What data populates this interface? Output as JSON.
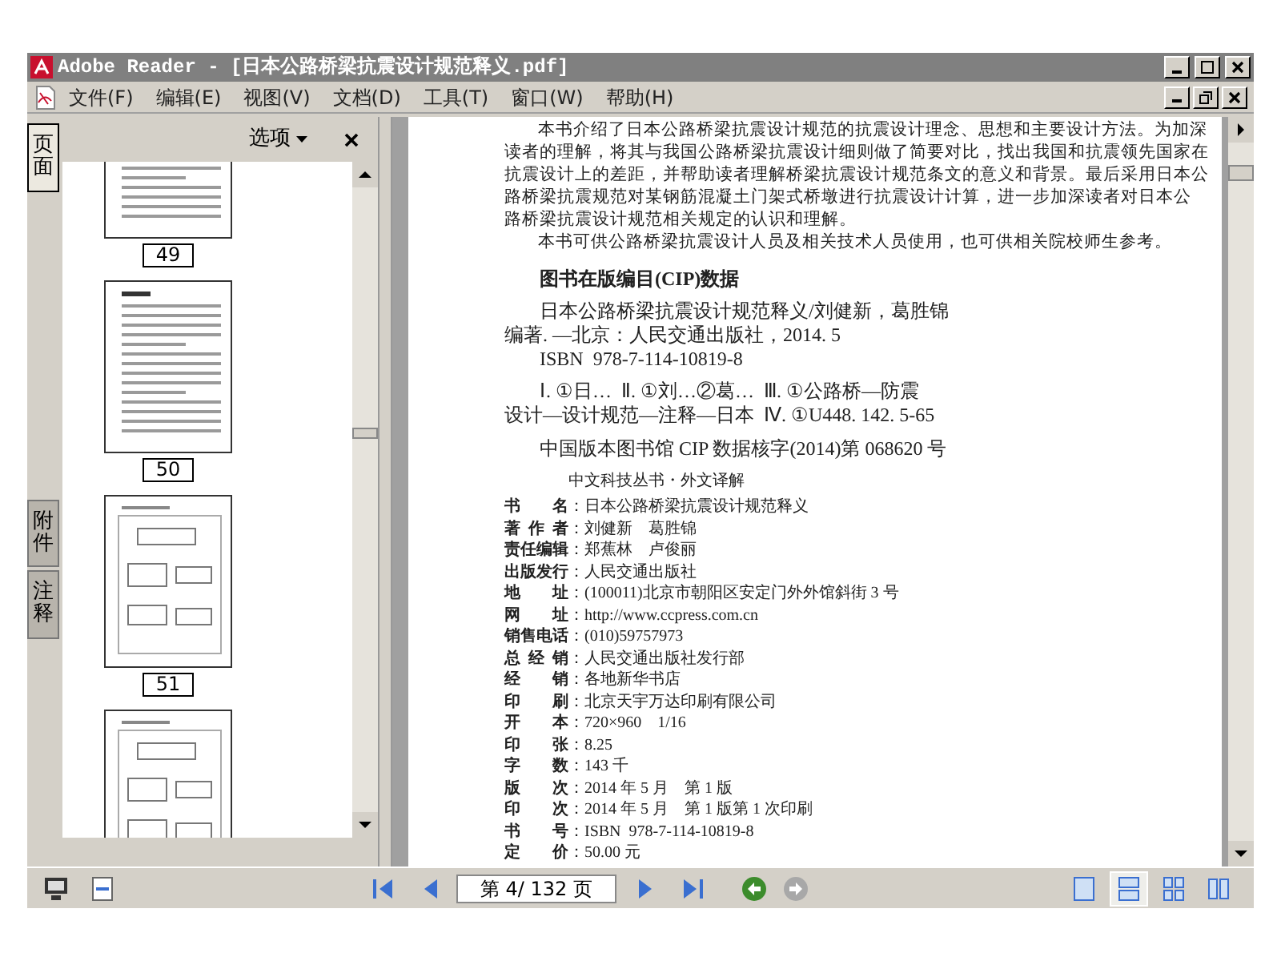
{
  "window": {
    "title": "Adobe Reader - [日本公路桥梁抗震设计规范释义.pdf]"
  },
  "menu": [
    {
      "label": "文件(F)"
    },
    {
      "label": "编辑(E)"
    },
    {
      "label": "视图(V)"
    },
    {
      "label": "文档(D)"
    },
    {
      "label": "工具(T)"
    },
    {
      "label": "窗口(W)"
    },
    {
      "label": "帮助(H)"
    }
  ],
  "side_tabs": [
    {
      "label": "页面",
      "selected": true
    },
    {
      "label": "附件",
      "selected": false
    },
    {
      "label": "注释",
      "selected": false
    }
  ],
  "panel": {
    "options": "选项"
  },
  "thumbnails": [
    {
      "kind": "text",
      "label": "49"
    },
    {
      "kind": "text",
      "label": "50"
    },
    {
      "kind": "figure",
      "label": "51"
    },
    {
      "kind": "figure"
    }
  ],
  "document": {
    "paragraph_lines": [
      "本书介绍了日本公路桥梁抗震设计规范的抗震设计理念、思想和主要设计方法。为加深",
      "读者的理解，将其与我国公路桥梁抗震设计细则做了简要对比，找出我国和抗震领先国家在",
      "抗震设计上的差距，并帮助读者理解桥梁抗震设计规范条文的意义和背景。最后采用日本公",
      "路桥梁抗震规范对某钢筋混凝土门架式桥墩进行抗震设计计算，进一步加深读者对日本公",
      "路桥梁抗震设计规范相关规定的认识和理解。",
      "本书可供公路桥梁抗震设计人员及相关技术人员使用，也可供相关院校师生参考。"
    ],
    "cip_heading": "图书在版编目(CIP)数据",
    "cip_lines": [
      {
        "text": "日本公路桥梁抗震设计规范释义/刘健新，葛胜锦",
        "indent": true
      },
      {
        "text": "编著. —北京：人民交通出版社，2014. 5",
        "indent": false
      },
      {
        "text": "ISBN  978-7-114-10819-8",
        "indent": true
      },
      {
        "text": "Ⅰ. ①日…  Ⅱ. ①刘…②葛…  Ⅲ. ①公路桥—防震",
        "indent": true
      },
      {
        "text": "设计—设计规范—注释—日本  Ⅳ. ①U448. 142. 5-65",
        "indent": false
      }
    ],
    "cip_number": "中国版本图书馆 CIP 数据核字(2014)第 068620 号",
    "series": "中文科技丛书・外文译解",
    "rows": [
      {
        "label": "书 名",
        "value": "：日本公路桥梁抗震设计规范释义"
      },
      {
        "label": "著 作 者",
        "value": "：刘健新　葛胜锦"
      },
      {
        "label": "责任编辑",
        "value": "：郑蕉林　卢俊丽"
      },
      {
        "label": "出版发行",
        "value": "：人民交通出版社"
      },
      {
        "label": "地 址",
        "value": "：(100011)北京市朝阳区安定门外外馆斜街 3 号"
      },
      {
        "label": "网 址",
        "value": "：http://www.ccpress.com.cn"
      },
      {
        "label": "销售电话",
        "value": "：(010)59757973"
      },
      {
        "label": "总 经 销",
        "value": "：人民交通出版社发行部"
      },
      {
        "label": "经 销",
        "value": "：各地新华书店"
      },
      {
        "label": "印 刷",
        "value": "：北京天宇万达印刷有限公司"
      },
      {
        "label": "开 本",
        "value": "：720×960　1/16"
      },
      {
        "label": "印 张",
        "value": "：8.25"
      },
      {
        "label": "字 数",
        "value": "：143 千"
      },
      {
        "label": "版 次",
        "value": "：2014 年 5 月　第 1 版"
      },
      {
        "label": "印 次",
        "value": "：2014 年 5 月　第 1 版第 1 次印刷"
      },
      {
        "label": "书 号",
        "value": "：ISBN  978-7-114-10819-8"
      },
      {
        "label": "定 价",
        "value": "：50.00 元"
      }
    ]
  },
  "toolbar": {
    "page_field": "第 4/ 132 页",
    "history": [
      {
        "disabled": false
      },
      {
        "disabled": true
      }
    ],
    "view_modes": [
      {
        "selected": false
      },
      {
        "selected": true
      },
      {
        "selected": false
      },
      {
        "selected": false
      }
    ]
  }
}
